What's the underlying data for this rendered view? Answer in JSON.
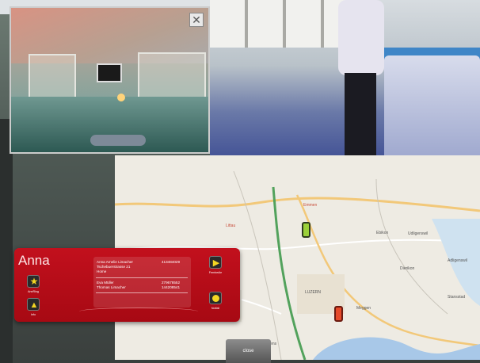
{
  "contact": {
    "name": "Anna",
    "primary": {
      "line1": "Anna Amelie Limacher",
      "line2": "Tschebuerstrasse 21",
      "line3": "Home",
      "phone": "413484029"
    },
    "contacts": [
      {
        "name": "Eva Müller",
        "phone": "279678552"
      },
      {
        "name": "Thomas Limacher",
        "phone": "144208541"
      }
    ],
    "buttons": {
      "left_top_caption": "AnnRing",
      "left_bottom_caption": "Info",
      "right_top_caption": "Fernbedie",
      "right_bottom_caption": "Notfall"
    }
  },
  "close_button": {
    "label": "close"
  },
  "camera": {
    "close_glyph": "✕"
  },
  "map": {
    "labels": {
      "top": "Emmen",
      "left": "Littau",
      "center": "LUZERN",
      "right_top": "Ebikon",
      "right_mid": "Dierikon",
      "right_low": "Meggen",
      "lake": "Kriens",
      "far_right": "Stansstad",
      "udligenswil": "Udligenswil",
      "adligenswil": "Adligenswil"
    },
    "marker_colors": {
      "green": "#9bd13a",
      "red": "#e64a2a"
    }
  },
  "colors": {
    "card_red": "#c2101d",
    "button_yellow": "#f4d623"
  }
}
